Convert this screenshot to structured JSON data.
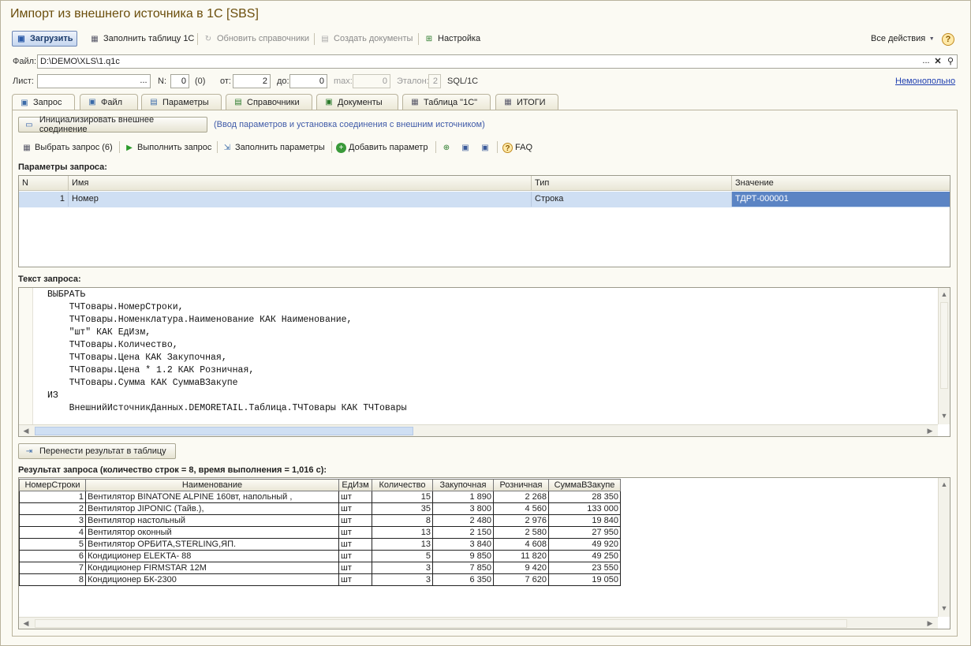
{
  "window": {
    "title": "Импорт из внешнего источника в 1С [SBS]"
  },
  "toolbar": {
    "load": "Загрузить",
    "fill_table": "Заполнить таблицу 1С",
    "refresh_refs": "Обновить справочники",
    "create_docs": "Создать документы",
    "settings": "Настройка",
    "all_actions": "Все действия",
    "help": "?"
  },
  "file": {
    "label": "Файл:",
    "value": "D:\\DEMO\\XLS\\1.q1c",
    "dots": "...",
    "clear": "✕",
    "search": "🔍"
  },
  "sheet": {
    "label": "Лист:",
    "value": "",
    "dots": "...",
    "n_label": "N:",
    "n_value": "0",
    "n_count": "(0)",
    "from_label": "от:",
    "from_value": "2",
    "to_label": "до:",
    "to_value": "0",
    "max_label": "max:",
    "max_value": "0",
    "etalon_label": "Эталон:",
    "etalon_value": "2",
    "mode": "SQL/1C",
    "link": "Немонопольно"
  },
  "tabs": [
    {
      "label": "Запрос",
      "icon": "query-icon"
    },
    {
      "label": "Файл",
      "icon": "file-icon"
    },
    {
      "label": "Параметры",
      "icon": "params-icon"
    },
    {
      "label": "Справочники",
      "icon": "refs-icon"
    },
    {
      "label": "Документы",
      "icon": "docs-icon"
    },
    {
      "label": "Таблица \"1С\"",
      "icon": "table-icon"
    },
    {
      "label": "ИТОГИ",
      "icon": "totals-icon"
    }
  ],
  "query_tab": {
    "init_button": "Инициализировать внешнее соединение",
    "init_hint": "(Ввод параметров и установка соединения с внешним источником)",
    "select_query": "Выбрать запрос (6)",
    "run_query": "Выполнить запрос",
    "fill_params": "Заполнить параметры",
    "add_param": "Добавить параметр",
    "faq": "FAQ",
    "params_title": "Параметры запроса:",
    "params_headers": [
      "N",
      "Имя",
      "Тип",
      "Значение"
    ],
    "params_rows": [
      {
        "n": "1",
        "name": "Номер",
        "type": "Строка",
        "value": "ТДРТ-000001"
      }
    ],
    "text_title": "Текст запроса:",
    "query_lines": [
      "ВЫБРАТЬ",
      "    ТЧТовары.НомерСтроки,",
      "    ТЧТовары.Номенклатура.Наименование КАК Наименование,",
      "    \"шт\" КАК ЕдИзм,",
      "    ТЧТовары.Количество,",
      "    ТЧТовары.Цена КАК Закупочная,",
      "    ТЧТовары.Цена * 1.2 КАК Розничная,",
      "    ТЧТовары.Сумма КАК СуммаВЗакупе",
      "ИЗ",
      "    ВнешнийИсточникДанных.DEMORETAIL.Таблица.ТЧТовары КАК ТЧТовары"
    ],
    "transfer_button": "Перенести результат в таблицу",
    "result_title": "Результат запроса (количество строк = 8, время выполнения = 1,016 с):",
    "result_headers": [
      "НомерСтроки",
      "Наименование",
      "ЕдИзм",
      "Количество",
      "Закупочная",
      "Розничная",
      "СуммаВЗакупе"
    ],
    "result_rows": [
      [
        "1",
        "Вентилятор BINATONE ALPINE 160вт, напольный ,",
        "шт",
        "15",
        "1 890",
        "2 268",
        "28 350"
      ],
      [
        "2",
        "Вентилятор JIPONIC (Тайв.),",
        "шт",
        "35",
        "3 800",
        "4 560",
        "133 000"
      ],
      [
        "3",
        "Вентилятор настольный",
        "шт",
        "8",
        "2 480",
        "2 976",
        "19 840"
      ],
      [
        "4",
        "Вентилятор оконный",
        "шт",
        "13",
        "2 150",
        "2 580",
        "27 950"
      ],
      [
        "5",
        "Вентилятор ОРБИТА,STERLING,ЯП.",
        "шт",
        "13",
        "3 840",
        "4 608",
        "49 920"
      ],
      [
        "6",
        "Кондиционер ELEKTA- 88",
        "шт",
        "5",
        "9 850",
        "11 820",
        "49 250"
      ],
      [
        "7",
        "Кондиционер FIRMSTAR 12M",
        "шт",
        "3",
        "7 850",
        "9 420",
        "23 550"
      ],
      [
        "8",
        "Кондиционер БК-2300",
        "шт",
        "3",
        "6 350",
        "7 620",
        "19 050"
      ]
    ]
  }
}
